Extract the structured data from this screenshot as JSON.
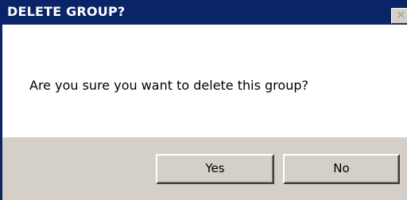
{
  "dialog": {
    "title": "DELETE GROUP?",
    "close_glyph": "✕",
    "message": "Are you sure you want to delete this group?",
    "buttons": {
      "yes_label": "Yes",
      "no_label": "No"
    }
  },
  "colors": {
    "titlebar": "#0a246a",
    "title_text": "#ffffff",
    "footer": "#d4d0c8",
    "body": "#ffffff"
  }
}
